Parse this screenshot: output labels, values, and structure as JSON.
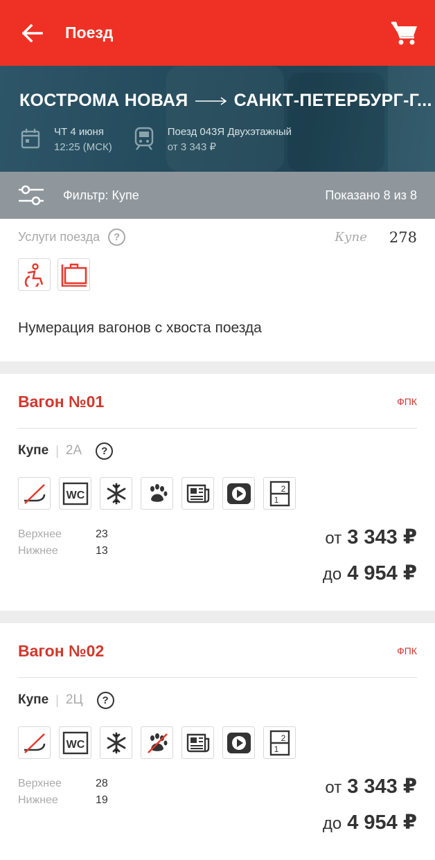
{
  "appbar": {
    "title": "Поезд",
    "back_icon": "arrow-left-icon",
    "cart_icon": "cart-icon"
  },
  "route": {
    "from": "КОСТРОМА НОВАЯ",
    "to": "САНКТ-ПЕТЕРБУРГ-Г...",
    "date": "ЧТ 4 июня",
    "time": "12:25 (МСК)",
    "train": "Поезд 043Я Двухэтажный",
    "price_from": "от 3 343 ₽"
  },
  "filter": {
    "label": "Фильтр: Купе",
    "count": "Показано 8 из 8"
  },
  "services": {
    "label": "Услуги поезда",
    "help": "?",
    "class_name": "Купе",
    "class_count": "278",
    "numbering": "Нумерация вагонов с хвоста поезда"
  },
  "cars": [
    {
      "title": "Вагон №01",
      "carrier": "ФПК",
      "class": "Купе",
      "sep": "|",
      "code": "2А",
      "help": "?",
      "seats": [
        {
          "label": "Верхнее",
          "value": "23"
        },
        {
          "label": "Нижнее",
          "value": "13"
        }
      ],
      "price_from_pre": "от",
      "price_from": "3 343 ₽",
      "price_to_pre": "до",
      "price_to": "4 954 ₽"
    },
    {
      "title": "Вагон №02",
      "carrier": "ФПК",
      "class": "Купе",
      "sep": "|",
      "code": "2Ц",
      "help": "?",
      "seats": [
        {
          "label": "Верхнее",
          "value": "28"
        },
        {
          "label": "Нижнее",
          "value": "19"
        }
      ],
      "price_from_pre": "от",
      "price_from": "3 343 ₽",
      "price_to_pre": "до",
      "price_to": "4 954 ₽"
    }
  ],
  "amenity_icons": {
    "wc": "WC",
    "car_1": [
      "no-smoking-icon",
      "wc-icon",
      "snowflake-icon",
      "paw-icon",
      "newspaper-icon",
      "play-icon",
      "berth-icon"
    ],
    "car_2": [
      "no-smoking-icon",
      "wc-icon",
      "snowflake-icon",
      "no-pets-icon",
      "newspaper-icon",
      "play-icon",
      "berth-icon"
    ]
  },
  "colors": {
    "accent": "#ee3124",
    "title_red": "#d0382e",
    "hero": "#244b5c",
    "filter_bar": "#8f979d"
  }
}
